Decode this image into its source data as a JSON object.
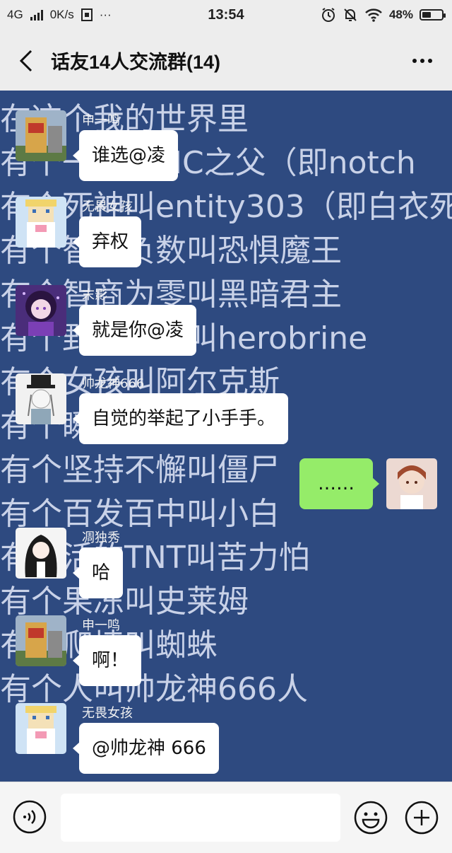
{
  "status_bar": {
    "network": "4G",
    "speed": "0K/s",
    "extra_icon": "sim-icon",
    "dots": "···",
    "time": "13:54",
    "battery": "48%",
    "battery_level": 0.48
  },
  "header": {
    "title": "话友14人交流群(14)"
  },
  "wallpaper_lines": [
    "在这个我的世界里",
    "有个一父叫MC之父（即notch",
    "有个死神叫entity303（即白衣死",
    "有个智商负数叫恐惧魔王",
    "有个智商为零叫黑暗君主",
    "有个野心勃勃叫herobrine",
    "有个女孩叫阿尔克斯",
    "有个瞬移叫末影人",
    "有个坚持不懈叫僵尸",
    "有个百发百中叫小白",
    "有个活的TNT叫苦力怕",
    "有个果冻叫史莱姆",
    "有个爬墙叫蜘蛛",
    "有个人叫帅龙神666人"
  ],
  "messages": [
    {
      "sender": "申一鸣",
      "text": "谁选@凌",
      "avatar": "avatar-building"
    },
    {
      "sender": "无畏女孩",
      "text": "弃权",
      "avatar": "avatar-blocky-girl"
    },
    {
      "sender": "末影",
      "text": "就是你@凌",
      "avatar": "avatar-purple-girl"
    },
    {
      "sender": "帅龙神666",
      "text": "自觉的举起了小手手。",
      "avatar": "avatar-top-hat"
    },
    {
      "sender": "",
      "text": "……",
      "avatar": "avatar-self",
      "mine": true
    },
    {
      "sender": "凋独秀",
      "text": "哈",
      "avatar": "avatar-dark-hair"
    },
    {
      "sender": "申一鸣",
      "text": "啊！",
      "avatar": "avatar-building"
    },
    {
      "sender": "无畏女孩",
      "text": "@帅龙神 666",
      "avatar": "avatar-blocky-girl"
    }
  ],
  "input_bar": {
    "voice_icon": "voice-icon",
    "emoji_icon": "emoji-icon",
    "plus_icon": "plus-icon"
  },
  "colors": {
    "chat_background": "#2e4a80",
    "my_bubble": "#95ec69",
    "other_bubble": "#ffffff"
  }
}
